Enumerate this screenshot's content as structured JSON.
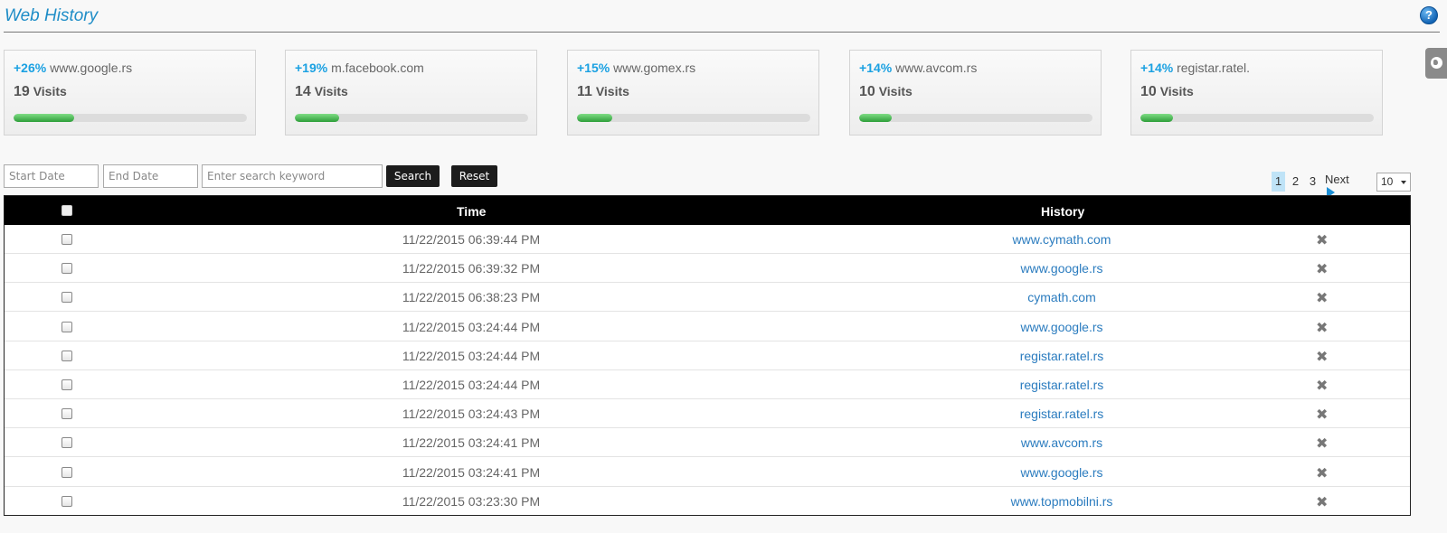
{
  "header": {
    "title": "Web History",
    "help_icon": "help-icon"
  },
  "side_tab": {
    "icon": "globe-icon"
  },
  "cards": [
    {
      "pct": "+26%",
      "site": "www.google.rs",
      "visits_num": "19",
      "visits_label": "Visits",
      "progress_pct": 26
    },
    {
      "pct": "+19%",
      "site": "m.facebook.com",
      "visits_num": "14",
      "visits_label": "Visits",
      "progress_pct": 19
    },
    {
      "pct": "+15%",
      "site": "www.gomex.rs",
      "visits_num": "11",
      "visits_label": "Visits",
      "progress_pct": 15
    },
    {
      "pct": "+14%",
      "site": "www.avcom.rs",
      "visits_num": "10",
      "visits_label": "Visits",
      "progress_pct": 14
    },
    {
      "pct": "+14%",
      "site": "registar.ratel.",
      "visits_num": "10",
      "visits_label": "Visits",
      "progress_pct": 14
    }
  ],
  "filter": {
    "start_placeholder": "Start Date",
    "end_placeholder": "End Date",
    "keyword_placeholder": "Enter search keyword",
    "search_label": "Search",
    "reset_label": "Reset"
  },
  "pager": {
    "pages": [
      "1",
      "2",
      "3"
    ],
    "active": "1",
    "next_label": "Next",
    "per_page": "10"
  },
  "table": {
    "columns": {
      "time": "Time",
      "history": "History"
    },
    "rows": [
      {
        "time": "11/22/2015 06:39:44 PM",
        "history": "www.cymath.com"
      },
      {
        "time": "11/22/2015 06:39:32 PM",
        "history": "www.google.rs"
      },
      {
        "time": "11/22/2015 06:38:23 PM",
        "history": "cymath.com"
      },
      {
        "time": "11/22/2015 03:24:44 PM",
        "history": "www.google.rs"
      },
      {
        "time": "11/22/2015 03:24:44 PM",
        "history": "registar.ratel.rs"
      },
      {
        "time": "11/22/2015 03:24:44 PM",
        "history": "registar.ratel.rs"
      },
      {
        "time": "11/22/2015 03:24:43 PM",
        "history": "registar.ratel.rs"
      },
      {
        "time": "11/22/2015 03:24:41 PM",
        "history": "www.avcom.rs"
      },
      {
        "time": "11/22/2015 03:24:41 PM",
        "history": "www.google.rs"
      },
      {
        "time": "11/22/2015 03:23:30 PM",
        "history": "www.topmobilni.rs"
      }
    ],
    "delete_glyph": "✖"
  }
}
